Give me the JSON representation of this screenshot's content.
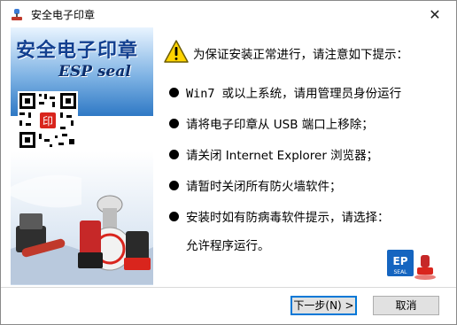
{
  "window": {
    "title": "安全电子印章",
    "close_glyph": "✕"
  },
  "banner": {
    "title": "安全电子印章",
    "subtitle": "ESP seal",
    "qr_stamp": "印"
  },
  "message": {
    "heading": "为保证安装正常进行，请注意如下提示：",
    "items": [
      "Win7 或以上系统，请用管理员身份运行",
      "请将电子印章从 USB 端口上移除；",
      "请关闭 Internet Explorer 浏览器；",
      "请暂时关闭所有防火墙软件；",
      "安装时如有防病毒软件提示，请选择："
    ],
    "continuation": "允许程序运行。"
  },
  "logo": {
    "text_top": "EP",
    "text_bottom": "SEAL"
  },
  "buttons": {
    "next": "下一步(N) >",
    "cancel": "取消"
  },
  "colors": {
    "accent": "#0078d7",
    "banner_title": "#123f8f",
    "warning": "#ffd400"
  },
  "icons": {
    "app": "stamp-app-icon",
    "warning": "warning-icon",
    "close": "close-icon"
  }
}
